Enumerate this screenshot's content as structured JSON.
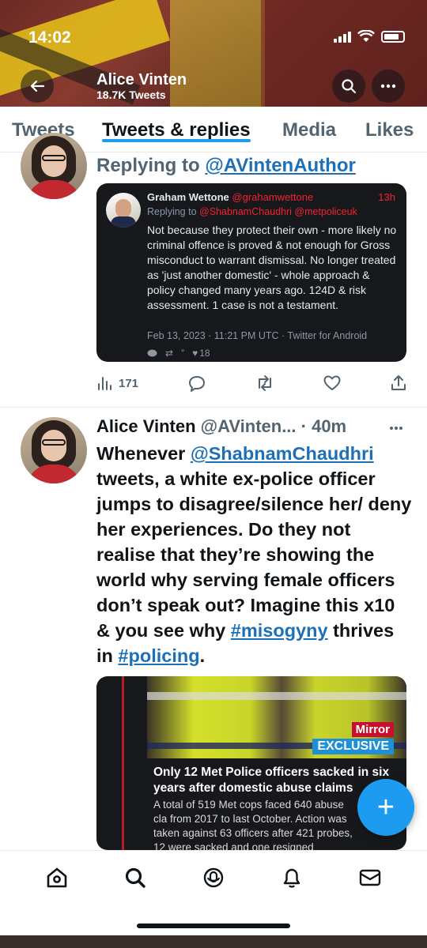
{
  "status_bar": {
    "time": "14:02"
  },
  "header": {
    "name": "Alice Vinten",
    "tweet_count": "18.7K Tweets"
  },
  "tabs": [
    {
      "label": "Tweets",
      "active": false
    },
    {
      "label": "Tweets & replies",
      "active": true
    },
    {
      "label": "Media",
      "active": false
    },
    {
      "label": "Likes",
      "active": false
    }
  ],
  "tweet1": {
    "replying_prefix": "Replying to ",
    "replying_handle": "@AVintenAuthor",
    "quote": {
      "name": "Graham Wettone",
      "handle": "@grahamwettone",
      "time": "13h",
      "replying_prefix": "Replying to ",
      "replying_handles": "@ShabnamChaudhri @metpoliceuk",
      "body": "Not because they protect their own - more likely no criminal offence is proved & not enough for Gross misconduct to warrant dismissal. No longer treated as 'just another domestic' - whole approach & policy changed many years ago. 124D & risk assessment. 1 case is not a testament.",
      "meta": "Feb 13, 2023 · 11:21 PM UTC · Twitter for Android",
      "likes": "18"
    },
    "views": "171"
  },
  "tweet2": {
    "name": "Alice Vinten",
    "handle_time": "@AVinten... · 40m",
    "body_parts": [
      {
        "text": "Whenever ",
        "link": false
      },
      {
        "text": "@ShabnamChaudhri",
        "link": true
      },
      {
        "text": " tweets, a white ex-police officer jumps to disagree/silence her/ deny her experiences. Do they not realise that they’re showing the world why serving female officers don’t speak out? Imagine this x10 & you see why ",
        "link": false
      },
      {
        "text": "#misogyny",
        "link": true
      },
      {
        "text": " thrives in ",
        "link": false
      },
      {
        "text": "#policing",
        "link": true
      },
      {
        "text": ".",
        "link": false
      }
    ],
    "card": {
      "badge_top": "Mirror",
      "badge_bottom": "EXCLUSIVE",
      "title": "Only 12 Met Police officers sacked in six years after domestic abuse claims",
      "body": "A total of 519 Met cops faced 640 abuse cla from 2017 to last October. Action was taken against 63 officers after 421 probes, 12 were sacked and one resigned"
    }
  },
  "fab": {
    "symbol": "+"
  },
  "colors": {
    "accent": "#1d9bf0",
    "link": "#1d70b8",
    "quote_red": "#f4212e",
    "mirror_red": "#c8102e"
  },
  "bottom_nav": [
    "home-icon",
    "search-icon",
    "spaces-icon",
    "bell-icon",
    "mail-icon"
  ]
}
